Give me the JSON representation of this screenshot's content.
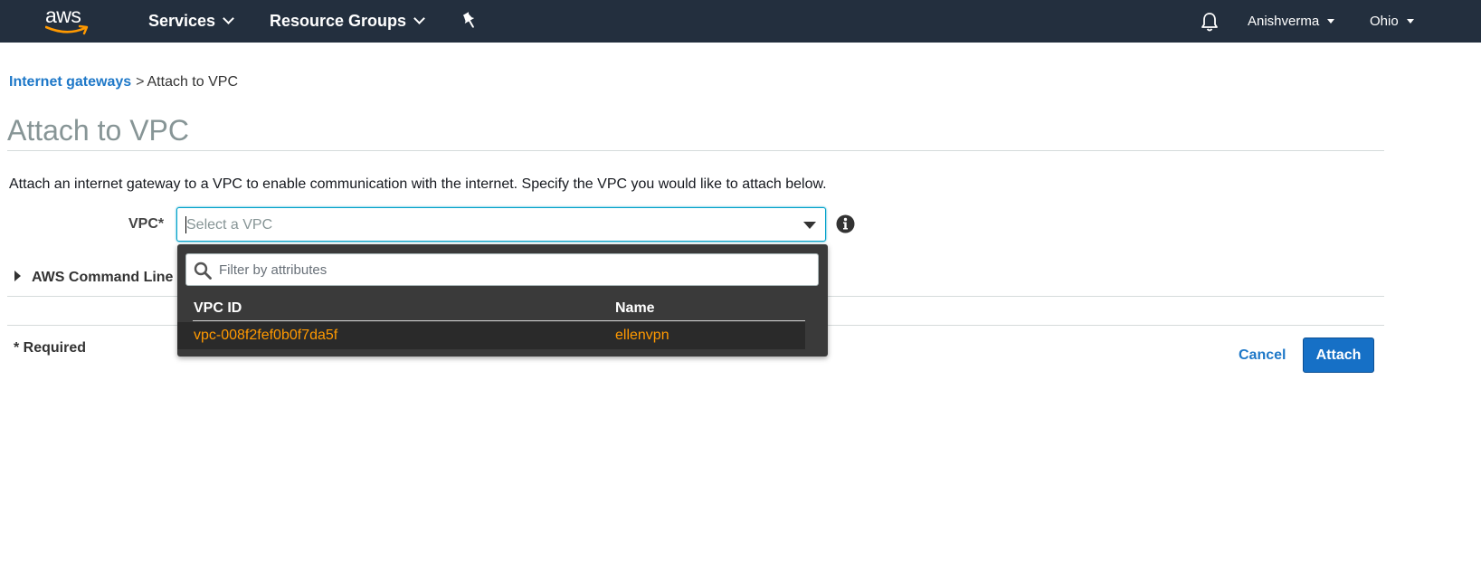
{
  "nav": {
    "logo": "aws",
    "services_label": "Services",
    "resource_groups_label": "Resource Groups",
    "pin_icon": "pin-icon",
    "bell_icon": "bell-icon",
    "user": "Anishverma",
    "region": "Ohio"
  },
  "breadcrumb": {
    "parent": "Internet gateways",
    "separator": ">",
    "current": "Attach to VPC"
  },
  "page": {
    "title": "Attach to VPC",
    "description": "Attach an internet gateway to a VPC to enable communication with the internet. Specify the VPC you would like to attach below."
  },
  "form": {
    "vpc_label": "VPC*",
    "vpc_placeholder": "Select a VPC",
    "info_icon": "info-icon",
    "cli_toggle": "AWS Command Line",
    "required_note": "* Required",
    "cancel_label": "Cancel",
    "attach_label": "Attach"
  },
  "dropdown": {
    "filter_placeholder": "Filter by attributes",
    "columns": [
      "VPC ID",
      "Name"
    ],
    "rows": [
      {
        "vpc_id": "vpc-008f2fef0b0f7da5f",
        "name": "ellenvpn"
      }
    ]
  },
  "colors": {
    "nav_bg": "#232f3e",
    "link": "#1e78c8",
    "primary_button": "#1670c6",
    "dropdown_bg": "#3a3a3a",
    "option_text": "#ff9900",
    "focus_border": "#00a1c9"
  }
}
